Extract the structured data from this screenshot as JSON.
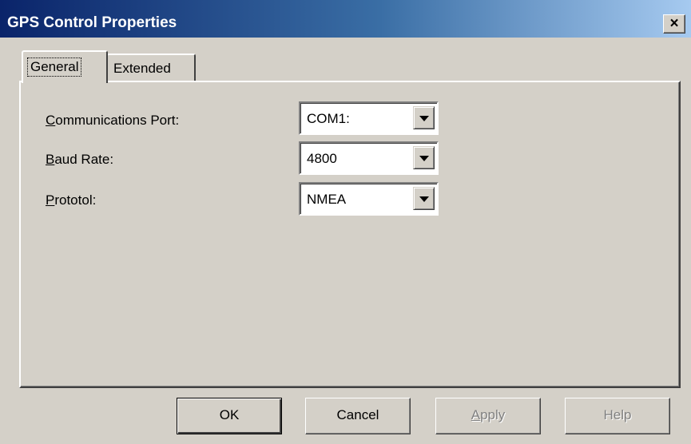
{
  "window": {
    "title": "GPS Control Properties",
    "close_glyph": "×"
  },
  "tabs": [
    {
      "label": "General",
      "selected": true
    },
    {
      "label": "Extended",
      "selected": false
    }
  ],
  "fields": [
    {
      "label_accel": "C",
      "label_rest": "ommunications Port:",
      "value": "COM1:"
    },
    {
      "label_accel": "B",
      "label_rest": "aud Rate:",
      "value": "4800"
    },
    {
      "label_accel": "P",
      "label_rest": "rototol:",
      "value": "NMEA"
    }
  ],
  "buttons": {
    "ok": "OK",
    "cancel": "Cancel",
    "apply_accel": "A",
    "apply_rest": "pply",
    "help": "Help"
  },
  "colors": {
    "face": "#d4d0c8",
    "title_start": "#0a246a",
    "title_end": "#a6caf0"
  }
}
